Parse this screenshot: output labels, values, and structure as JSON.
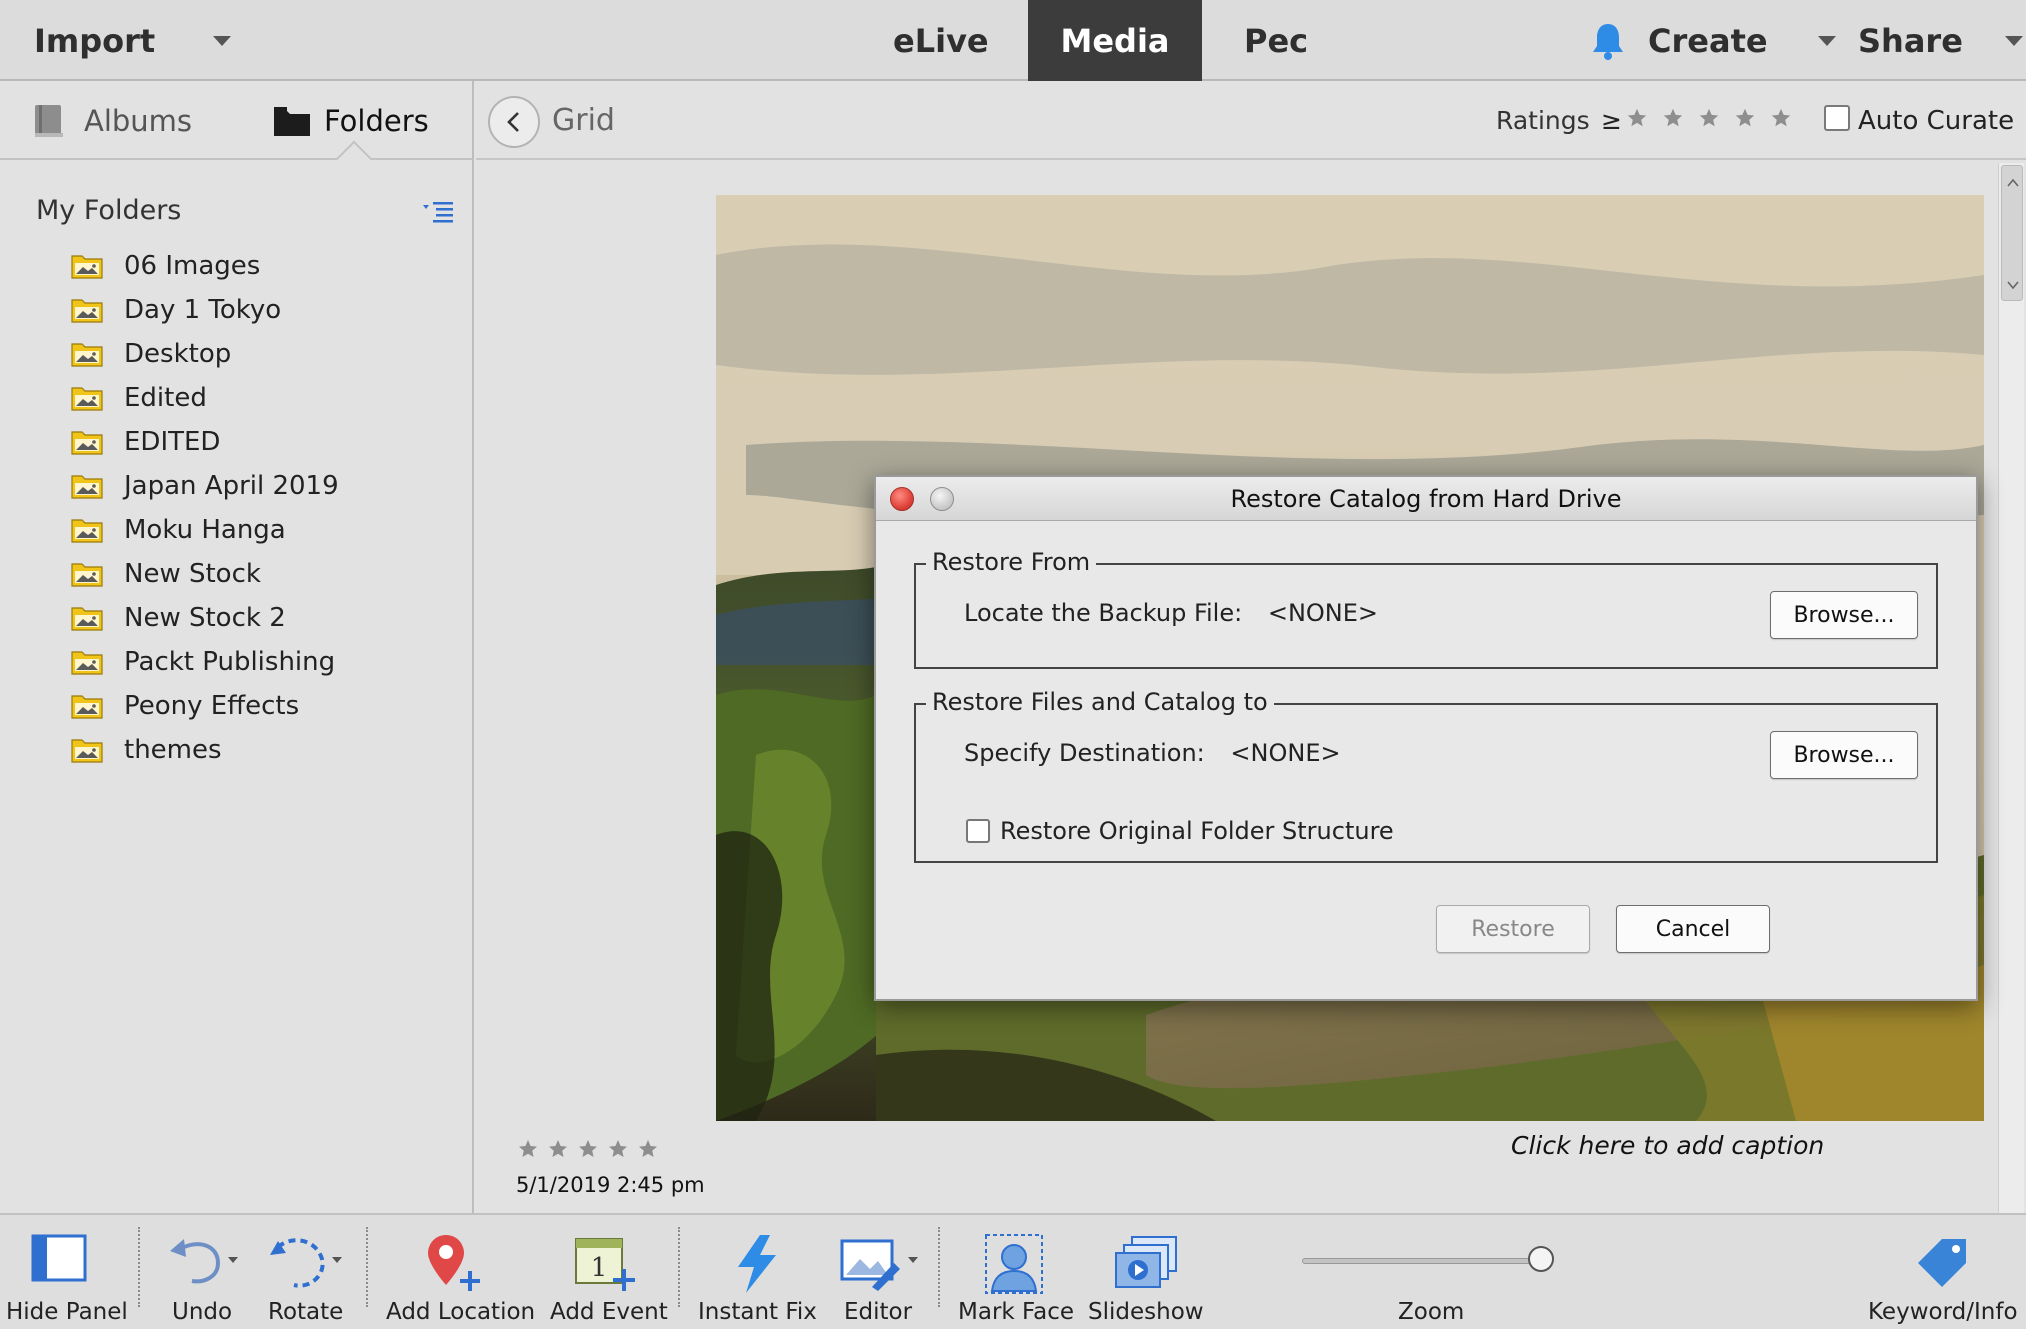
{
  "topbar": {
    "import_label": "Import",
    "elive_label": "eLive",
    "media_label": "Media",
    "pec_label": "Pec",
    "create_label": "Create",
    "share_label": "Share"
  },
  "left_panel": {
    "albums_label": "Albums",
    "folders_label": "Folders",
    "my_folders_title": "My Folders",
    "folders": [
      {
        "label": "06 Images"
      },
      {
        "label": "Day 1 Tokyo"
      },
      {
        "label": "Desktop"
      },
      {
        "label": "Edited"
      },
      {
        "label": "EDITED"
      },
      {
        "label": "Japan April 2019"
      },
      {
        "label": "Moku Hanga"
      },
      {
        "label": "New Stock"
      },
      {
        "label": "New Stock 2"
      },
      {
        "label": "Packt Publishing"
      },
      {
        "label": "Peony Effects"
      },
      {
        "label": "themes"
      }
    ]
  },
  "main": {
    "view_label": "Grid",
    "ratings_label": "Ratings",
    "ratings_operator": "≥",
    "auto_curate_label": "Auto Curate",
    "photo": {
      "date": "5/1/2019 2:45 pm",
      "caption_placeholder": "Click here to add caption"
    }
  },
  "dialog": {
    "title": "Restore Catalog from Hard Drive",
    "restore_from_legend": "Restore From",
    "locate_label": "Locate the Backup File:",
    "locate_value": "<NONE>",
    "browse_label_1": "Browse...",
    "restore_to_legend": "Restore Files and Catalog to",
    "destination_label": "Specify Destination:",
    "destination_value": "<NONE>",
    "browse_label_2": "Browse...",
    "restore_structure_label": "Restore Original Folder Structure",
    "restore_button": "Restore",
    "cancel_button": "Cancel"
  },
  "bottombar": {
    "hide_panel": "Hide Panel",
    "undo": "Undo",
    "rotate": "Rotate",
    "add_location": "Add Location",
    "add_event": "Add Event",
    "instant_fix": "Instant Fix",
    "editor": "Editor",
    "mark_face": "Mark Face",
    "slideshow": "Slideshow",
    "zoom": "Zoom",
    "keyword_info": "Keyword/Info"
  },
  "colors": {
    "accent_blue": "#2e8ce6",
    "active_tab_bg": "#3c3c3c",
    "folder_yellow": "#f0c419",
    "location_red": "#e04848"
  }
}
